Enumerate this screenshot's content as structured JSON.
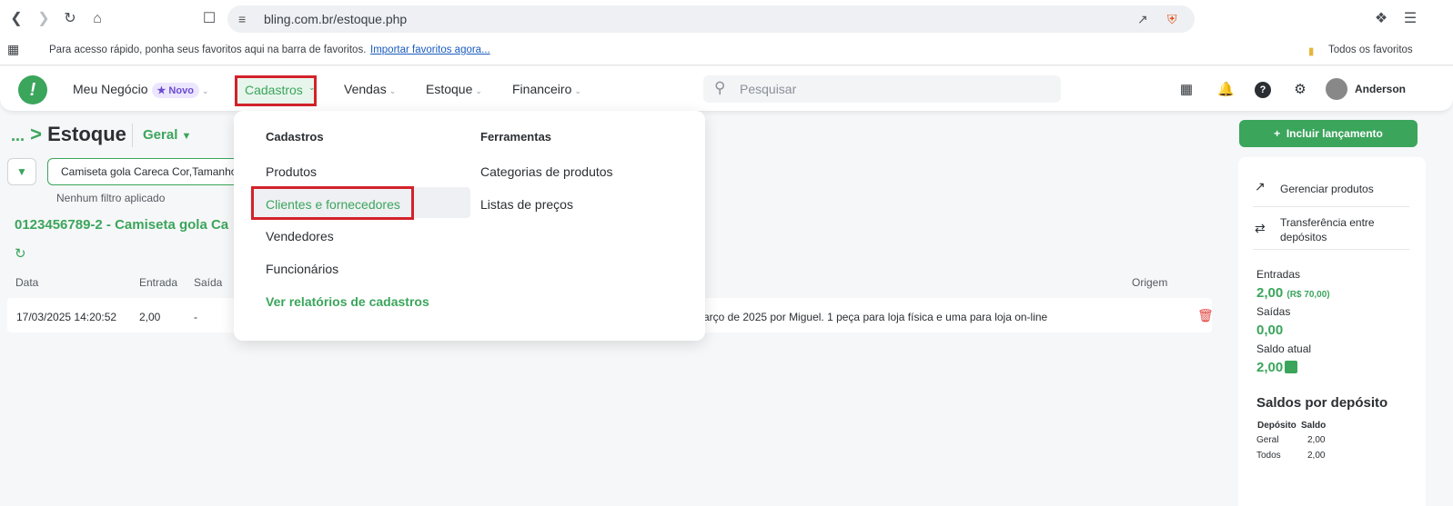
{
  "browser": {
    "url": "bling.com.br/estoque.php",
    "bookmarks_hint": "Para acesso rápido, ponha seus favoritos aqui na barra de favoritos.",
    "bookmarks_import": "Importar favoritos agora...",
    "all_favorites": "Todos os favoritos"
  },
  "header": {
    "menu": {
      "meu_negocio": "Meu Negócio",
      "novo_badge": "Novo",
      "cadastros": "Cadastros",
      "vendas": "Vendas",
      "estoque": "Estoque",
      "financeiro": "Financeiro"
    },
    "search_placeholder": "Pesquisar",
    "user_name": "Anderson"
  },
  "page": {
    "breadcrumb_dots": "...",
    "title": "Estoque",
    "deposit": "Geral",
    "product_search_value": "Camiseta gola Careca Cor,Tamanho",
    "no_filter": "Nenhum filtro aplicado",
    "product_title": "0123456789-2 - Camiseta gola Ca",
    "columns": [
      "Data",
      "Entrada",
      "Saída",
      "Origem"
    ],
    "rows": [
      {
        "date": "17/03/2025 14:20:52",
        "entrada": "2,00",
        "saida": "-",
        "obs": "março de 2025 por Miguel. 1 peça para loja física e uma para loja on-line"
      }
    ]
  },
  "dropdown": {
    "col1_heading": "Cadastros",
    "col1_items": [
      "Produtos",
      "Clientes e fornecedores",
      "Vendedores",
      "Funcionários"
    ],
    "col1_link": "Ver relatórios de cadastros",
    "col2_heading": "Ferramentas",
    "col2_items": [
      "Categorias de produtos",
      "Listas de preços"
    ]
  },
  "side": {
    "add_button": "Incluir lançamento",
    "manage_products": "Gerenciar produtos",
    "transfer_line1": "Transferência entre",
    "transfer_line2": "depósitos",
    "entradas_label": "Entradas",
    "entradas_value": "2,00",
    "entradas_money": "(R$ 70,00)",
    "saidas_label": "Saídas",
    "saidas_value": "0,00",
    "saldo_label": "Saldo atual",
    "saldo_value": "2,00",
    "deposits_heading": "Saldos por depósito",
    "deposit_table": {
      "headers": [
        "Depósito",
        "Saldo"
      ],
      "rows": [
        [
          "Geral",
          "2,00"
        ],
        [
          "Todos",
          "2,00"
        ]
      ]
    }
  },
  "colors": {
    "brand_green": "#3ba55c",
    "highlight_red": "#d3222a",
    "delete_red": "#e0443e"
  }
}
